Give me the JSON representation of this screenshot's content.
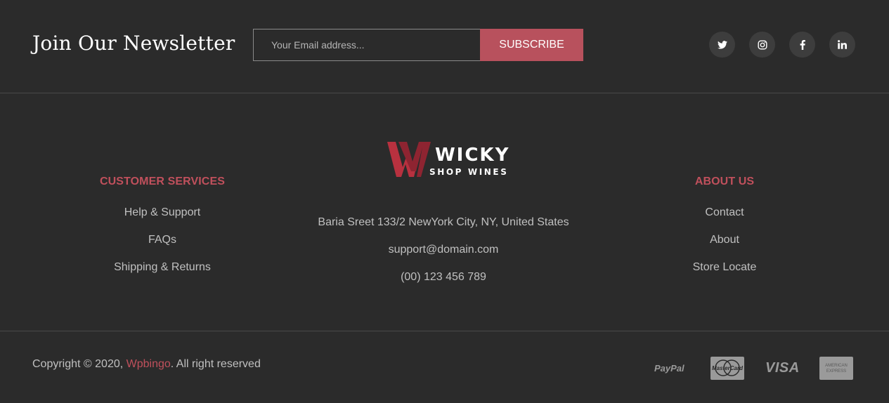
{
  "newsletter": {
    "title": "Join Our Newsletter",
    "email_placeholder": "Your Email address...",
    "subscribe_label": "SUBSCRIBE"
  },
  "socials": [
    "twitter-icon",
    "instagram-icon",
    "facebook-icon",
    "linkedin-icon"
  ],
  "logo": {
    "name": "WICKY",
    "tagline": "SHOP WINES"
  },
  "customer_services": {
    "title": "CUSTOMER SERVICES",
    "links": [
      "Help & Support",
      "FAQs",
      "Shipping & Returns"
    ]
  },
  "contact": {
    "address": "Baria Sreet 133/2 NewYork City, NY, United States",
    "email": "support@domain.com",
    "phone": "(00) 123 456 789"
  },
  "about_us": {
    "title": "ABOUT US",
    "links": [
      "Contact",
      "About",
      "Store Locate"
    ]
  },
  "copyright": {
    "prefix": "Copyright © 2020, ",
    "brand": "Wpbingo",
    "suffix": ". All right reserved"
  },
  "payments": {
    "paypal": "PayPal",
    "mastercard": "MasterCard",
    "visa": "VISA",
    "amex_line1": "AMERICAN",
    "amex_line2": "EXPRESS"
  },
  "colors": {
    "background": "#2b2b2b",
    "accent": "#b8515d",
    "heading_accent": "#c0505c",
    "text": "#c0c0c0",
    "social_bg": "#3d3d3d"
  }
}
